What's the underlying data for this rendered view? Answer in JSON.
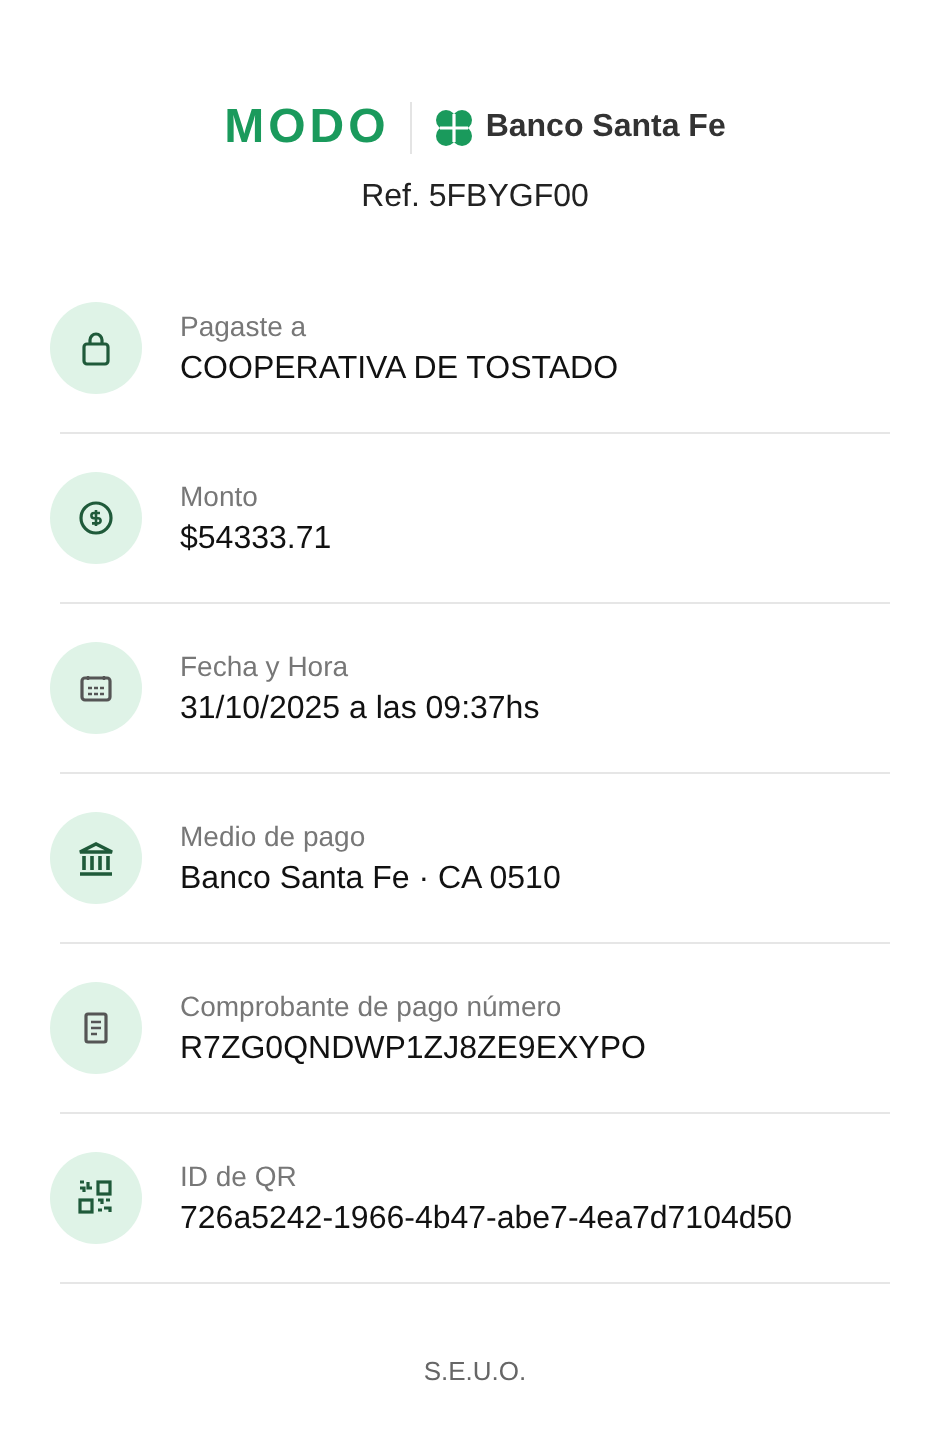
{
  "header": {
    "brand": "MODO",
    "bank": "Banco Santa Fe",
    "reference": "Ref. 5FBYGF00"
  },
  "details": [
    {
      "label": "Pagaste a",
      "value": "COOPERATIVA DE TOSTADO"
    },
    {
      "label": "Monto",
      "value": "$54333.71"
    },
    {
      "label": "Fecha y Hora",
      "value": "31/10/2025 a las 09:37hs"
    },
    {
      "label": "Medio de pago",
      "value": "Banco Santa Fe · CA 0510"
    },
    {
      "label": "Comprobante de pago número",
      "value": "R7ZG0QNDWP1ZJ8ZE9EXYPO"
    },
    {
      "label": "ID de QR",
      "value": "726a5242-1966-4b47-abe7-4ea7d7104d50"
    }
  ],
  "footer": "S.E.U.O."
}
